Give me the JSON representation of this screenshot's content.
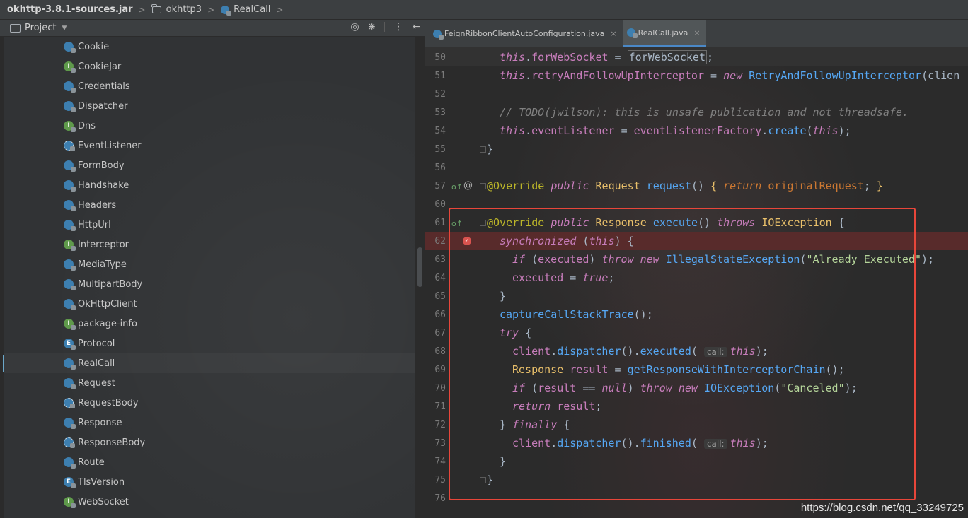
{
  "breadcrumb": {
    "jar": "okhttp-3.8.1-sources.jar",
    "package": "okhttp3",
    "class": "RealCall"
  },
  "project_panel": {
    "title": "Project",
    "tree": [
      {
        "label": "Cookie",
        "kind": "class"
      },
      {
        "label": "CookieJar",
        "kind": "interface"
      },
      {
        "label": "Credentials",
        "kind": "class"
      },
      {
        "label": "Dispatcher",
        "kind": "class"
      },
      {
        "label": "Dns",
        "kind": "interface"
      },
      {
        "label": "EventListener",
        "kind": "abstract"
      },
      {
        "label": "FormBody",
        "kind": "class"
      },
      {
        "label": "Handshake",
        "kind": "class"
      },
      {
        "label": "Headers",
        "kind": "class"
      },
      {
        "label": "HttpUrl",
        "kind": "class"
      },
      {
        "label": "Interceptor",
        "kind": "interface"
      },
      {
        "label": "MediaType",
        "kind": "class"
      },
      {
        "label": "MultipartBody",
        "kind": "class"
      },
      {
        "label": "OkHttpClient",
        "kind": "class"
      },
      {
        "label": "package-info",
        "kind": "interface"
      },
      {
        "label": "Protocol",
        "kind": "enum"
      },
      {
        "label": "RealCall",
        "kind": "class",
        "selected": true
      },
      {
        "label": "Request",
        "kind": "class"
      },
      {
        "label": "RequestBody",
        "kind": "abstract"
      },
      {
        "label": "Response",
        "kind": "class"
      },
      {
        "label": "ResponseBody",
        "kind": "abstract"
      },
      {
        "label": "Route",
        "kind": "class"
      },
      {
        "label": "TlsVersion",
        "kind": "enum"
      },
      {
        "label": "WebSocket",
        "kind": "interface"
      }
    ]
  },
  "tabs": [
    {
      "label": "FeignRibbonClientAutoConfiguration.java",
      "active": false
    },
    {
      "label": "RealCall.java",
      "active": true
    }
  ],
  "lines": {
    "l50": "50",
    "l51": "51",
    "l52": "52",
    "l53": "53",
    "l54": "54",
    "l55": "55",
    "l56": "56",
    "l57": "57",
    "l60": "60",
    "l61": "61",
    "l62": "62",
    "l63": "63",
    "l64": "64",
    "l65": "65",
    "l66": "66",
    "l67": "67",
    "l68": "68",
    "l69": "69",
    "l70": "70",
    "l71": "71",
    "l72": "72",
    "l73": "73",
    "l74": "74",
    "l75": "75",
    "l76": "76"
  },
  "code": {
    "comment53": "// TODO(jwilson): this is unsafe publication and not threadsafe.",
    "str_already": "\"Already Executed\"",
    "str_canceled": "\"Canceled\"",
    "hint_call": "call:"
  },
  "watermark": "https://blog.csdn.net/qq_33249725"
}
